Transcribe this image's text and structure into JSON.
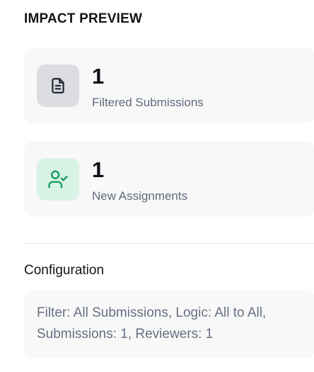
{
  "impact_preview": {
    "title": "IMPACT PREVIEW",
    "stats": [
      {
        "value": "1",
        "label": "Filtered Submissions",
        "icon": "document-icon"
      },
      {
        "value": "1",
        "label": "New Assignments",
        "icon": "user-check-icon"
      }
    ]
  },
  "configuration": {
    "title": "Configuration",
    "summary": "Filter: All Submissions, Logic: All to All, Submissions: 1, Reviewers: 1"
  },
  "colors": {
    "card_background": "#f8f8f9",
    "gray_icon_tile": "#dcdde1",
    "green_icon_tile": "#d8f3e6",
    "green_icon": "#1f9d63",
    "label_text": "#5f6b7a"
  }
}
